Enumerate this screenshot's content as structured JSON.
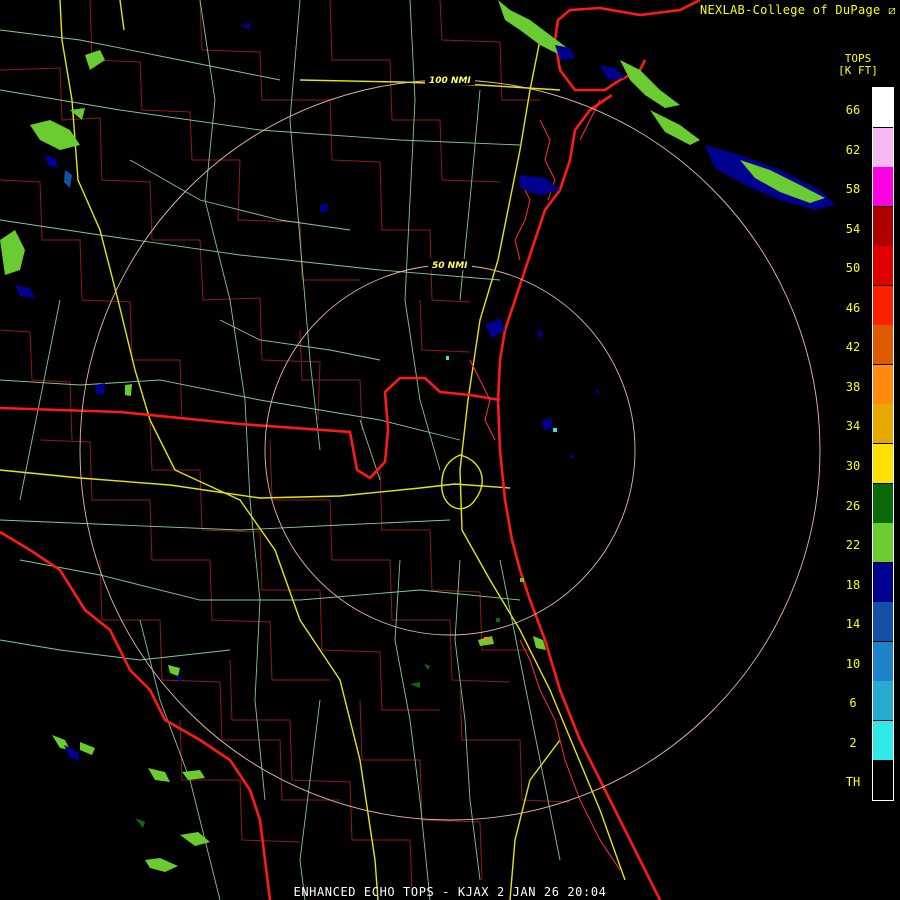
{
  "credit": "NEXLAB-College of DuPage",
  "legend": {
    "title_line1": "TOPS",
    "title_line2": "[K FT]",
    "entries": [
      {
        "label": "66",
        "color": "#ffffff"
      },
      {
        "label": "62",
        "color": "#f5b8f0"
      },
      {
        "label": "58",
        "color": "#ff00e0"
      },
      {
        "label": "54",
        "color": "#b00000"
      },
      {
        "label": "50",
        "color": "#e00000"
      },
      {
        "label": "46",
        "color": "#ff2000"
      },
      {
        "label": "42",
        "color": "#dd5a00"
      },
      {
        "label": "38",
        "color": "#ff8a10"
      },
      {
        "label": "34",
        "color": "#e8a800"
      },
      {
        "label": "30",
        "color": "#ffe000"
      },
      {
        "label": "26",
        "color": "#0a6a0a"
      },
      {
        "label": "22",
        "color": "#6acc30"
      },
      {
        "label": "18",
        "color": "#000090"
      },
      {
        "label": "14",
        "color": "#1450a8"
      },
      {
        "label": "10",
        "color": "#1e82c8"
      },
      {
        "label": "6",
        "color": "#28aad0"
      },
      {
        "label": "2",
        "color": "#30e8e8"
      },
      {
        "label": "TH",
        "color": "#000000"
      }
    ]
  },
  "range_rings": [
    {
      "label": "50 NMI",
      "range_nmi": 50
    },
    {
      "label": "100 NMI",
      "range_nmi": 100
    }
  ],
  "footer": "ENHANCED ECHO TOPS - KJAX 2 JAN 26 20:04"
}
